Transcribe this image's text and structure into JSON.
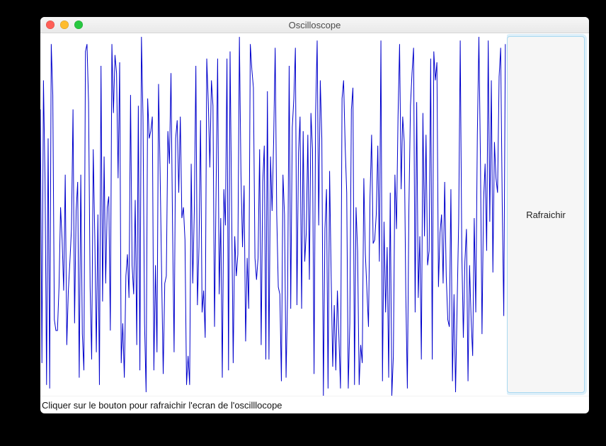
{
  "window": {
    "title": "Oscilloscope"
  },
  "sidebar": {
    "refresh_label": "Rafraichir"
  },
  "status": {
    "text": "Cliquer sur le bouton pour rafraichir l'ecran de l'oscilllocope"
  },
  "chart_data": {
    "type": "line",
    "title": "",
    "xlabel": "",
    "ylabel": "",
    "xlim": [
      0,
      300
    ],
    "ylim": [
      0,
      1
    ],
    "stroke": "#0000cc",
    "note": "Random noise signal, ~300 samples uniform [0,1]; no axes or ticks drawn",
    "x": [
      0,
      1,
      2,
      3,
      4,
      5,
      6,
      7,
      8,
      9,
      10,
      11,
      12,
      13,
      14,
      15,
      16,
      17,
      18,
      19,
      20,
      21,
      22,
      23,
      24,
      25,
      26,
      27,
      28,
      29,
      30,
      31,
      32,
      33,
      34,
      35,
      36,
      37,
      38,
      39,
      40,
      41,
      42,
      43,
      44,
      45,
      46,
      47,
      48,
      49,
      50,
      51,
      52,
      53,
      54,
      55,
      56,
      57,
      58,
      59,
      60,
      61,
      62,
      63,
      64,
      65,
      66,
      67,
      68,
      69,
      70,
      71,
      72,
      73,
      74,
      75,
      76,
      77,
      78,
      79,
      80,
      81,
      82,
      83,
      84,
      85,
      86,
      87,
      88,
      89,
      90,
      91,
      92,
      93,
      94,
      95,
      96,
      97,
      98,
      99,
      100,
      101,
      102,
      103,
      104,
      105,
      106,
      107,
      108,
      109,
      110,
      111,
      112,
      113,
      114,
      115,
      116,
      117,
      118,
      119,
      120,
      121,
      122,
      123,
      124,
      125,
      126,
      127,
      128,
      129,
      130,
      131,
      132,
      133,
      134,
      135,
      136,
      137,
      138,
      139,
      140,
      141,
      142,
      143,
      144,
      145,
      146,
      147,
      148,
      149,
      150,
      151,
      152,
      153,
      154,
      155,
      156,
      157,
      158,
      159,
      160,
      161,
      162,
      163,
      164,
      165,
      166,
      167,
      168,
      169,
      170,
      171,
      172,
      173,
      174,
      175,
      176,
      177,
      178,
      179,
      180,
      181,
      182,
      183,
      184,
      185,
      186,
      187,
      188,
      189,
      190,
      191,
      192,
      193,
      194,
      195,
      196,
      197,
      198,
      199,
      200,
      201,
      202,
      203,
      204,
      205,
      206,
      207,
      208,
      209,
      210,
      211,
      212,
      213,
      214,
      215,
      216,
      217,
      218,
      219,
      220,
      221,
      222,
      223,
      224,
      225,
      226,
      227,
      228,
      229,
      230,
      231,
      232,
      233,
      234,
      235,
      236,
      237,
      238,
      239,
      240,
      241,
      242,
      243,
      244,
      245,
      246,
      247,
      248,
      249,
      250,
      251,
      252,
      253,
      254,
      255,
      256,
      257,
      258,
      259,
      260,
      261,
      262,
      263,
      264,
      265,
      266,
      267,
      268,
      269,
      270,
      271,
      272,
      273,
      274,
      275,
      276,
      277,
      278,
      279,
      280,
      281,
      282,
      283,
      284,
      285,
      286,
      287,
      288,
      289,
      290,
      291,
      292,
      293,
      294,
      295,
      296,
      297,
      298,
      299
    ],
    "values": [
      0.79,
      0.09,
      0.87,
      0.6,
      0.03,
      0.71,
      0.02,
      0.97,
      0.83,
      0.21,
      0.18,
      0.18,
      0.3,
      0.52,
      0.43,
      0.29,
      0.61,
      0.14,
      0.29,
      0.37,
      0.46,
      0.79,
      0.2,
      0.51,
      0.59,
      0.05,
      0.61,
      0.17,
      0.07,
      0.95,
      0.97,
      0.81,
      0.3,
      0.1,
      0.68,
      0.44,
      0.12,
      0.5,
      0.03,
      0.91,
      0.26,
      0.66,
      0.31,
      0.52,
      0.55,
      0.18,
      0.97,
      0.78,
      0.94,
      0.89,
      0.6,
      0.92,
      0.09,
      0.2,
      0.05,
      0.33,
      0.39,
      0.27,
      0.83,
      0.36,
      0.28,
      0.54,
      0.14,
      0.8,
      0.07,
      0.99,
      0.77,
      0.2,
      0.01,
      0.82,
      0.71,
      0.73,
      0.77,
      0.07,
      0.36,
      0.12,
      0.86,
      0.62,
      0.33,
      0.06,
      0.31,
      0.33,
      0.73,
      0.64,
      0.89,
      0.47,
      0.12,
      0.71,
      0.76,
      0.56,
      0.77,
      0.49,
      0.52,
      0.43,
      0.03,
      0.11,
      0.03,
      0.64,
      0.31,
      0.51,
      0.91,
      0.25,
      0.41,
      0.76,
      0.23,
      0.29,
      0.16,
      0.93,
      0.81,
      0.63,
      0.87,
      0.8,
      0.19,
      0.57,
      0.93,
      0.28,
      0.49,
      0.05,
      0.57,
      0.47,
      0.93,
      0.07,
      0.95,
      0.52,
      0.09,
      0.44,
      0.33,
      0.39,
      0.99,
      0.61,
      0.41,
      0.58,
      0.15,
      0.38,
      0.24,
      0.97,
      0.9,
      0.85,
      0.38,
      0.32,
      0.38,
      0.68,
      0.14,
      0.59,
      0.69,
      0.1,
      0.84,
      0.1,
      0.66,
      0.51,
      0.7,
      0.96,
      0.5,
      0.3,
      0.28,
      0.04,
      0.61,
      0.5,
      0.05,
      0.28,
      0.91,
      0.24,
      0.74,
      0.82,
      0.96,
      0.25,
      0.67,
      0.77,
      0.24,
      0.73,
      0.37,
      0.45,
      0.72,
      0.32,
      0.78,
      0.68,
      0.06,
      0.78,
      0.98,
      0.47,
      0.87,
      0.71,
      0.0,
      0.46,
      0.57,
      0.02,
      0.62,
      0.33,
      0.08,
      0.25,
      0.07,
      0.29,
      0.16,
      0.02,
      0.82,
      0.87,
      0.69,
      0.56,
      0.02,
      0.2,
      0.79,
      0.85,
      0.03,
      0.52,
      0.4,
      0.03,
      0.14,
      0.09,
      0.6,
      0.39,
      0.29,
      0.19,
      0.55,
      0.72,
      0.42,
      0.43,
      0.5,
      0.69,
      0.37,
      0.98,
      0.04,
      0.48,
      0.23,
      0.41,
      0.05,
      0.56,
      0.0,
      0.11,
      0.61,
      0.46,
      0.77,
      0.97,
      0.57,
      0.77,
      0.7,
      0.28,
      0.02,
      0.52,
      0.8,
      0.89,
      0.96,
      0.23,
      0.81,
      0.27,
      0.44,
      0.1,
      0.78,
      0.44,
      0.72,
      0.36,
      0.4,
      0.93,
      0.1,
      0.95,
      0.87,
      0.92,
      0.3,
      0.45,
      0.5,
      0.31,
      0.59,
      0.33,
      0.21,
      0.19,
      0.57,
      0.04,
      0.28,
      0.01,
      0.25,
      0.48,
      0.98,
      0.4,
      0.16,
      0.37,
      0.46,
      0.04,
      0.36,
      0.21,
      0.11,
      0.49,
      0.23,
      0.72,
      0.99,
      0.65,
      0.17,
      0.54,
      0.64,
      0.4,
      0.98,
      0.48,
      0.87,
      0.34,
      0.7,
      0.6,
      0.56,
      0.88,
      0.96,
      0.53,
      0.22,
      0.97
    ]
  }
}
